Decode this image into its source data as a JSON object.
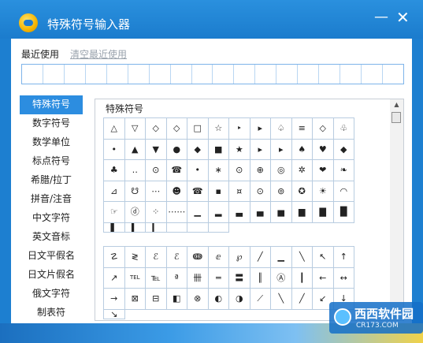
{
  "window": {
    "title": "特殊符号输入器",
    "minimize": "—",
    "close": "✕"
  },
  "recent": {
    "label": "最近使用",
    "clear": "清空最近使用",
    "slots": 18
  },
  "sidebar": {
    "items": [
      {
        "label": "特殊符号",
        "active": true
      },
      {
        "label": "数字符号"
      },
      {
        "label": "数学单位"
      },
      {
        "label": "标点符号"
      },
      {
        "label": "希腊/拉丁"
      },
      {
        "label": "拼音/注音"
      },
      {
        "label": "中文字符"
      },
      {
        "label": "英文音标"
      },
      {
        "label": "日文平假名"
      },
      {
        "label": "日文片假名"
      },
      {
        "label": "俄文字符"
      },
      {
        "label": "制表符"
      }
    ]
  },
  "panel": {
    "title": "特殊符号",
    "grid1": [
      [
        "△",
        "▽",
        "◇",
        "◇",
        "□",
        "☆",
        "‣",
        "▸",
        "♤",
        "≡",
        "◇",
        "♧",
        "•"
      ],
      [
        "▲",
        "▼",
        "●",
        "◆",
        "■",
        "★",
        "▸",
        "▸",
        "♠",
        "♥",
        "◆",
        "♣",
        "‥"
      ],
      [
        "⊙",
        "☎",
        "•",
        "∗",
        "⊙",
        "⊕",
        "◎",
        "✲",
        "❤",
        "❧",
        "⊿",
        "☋",
        "⋯"
      ],
      [
        "☻",
        "☎",
        "▪",
        "¤",
        "⊙",
        "⊚",
        "✪",
        "☀",
        "◠",
        "☞",
        "ⓓ",
        "⁘",
        "⋯⋯"
      ],
      [
        "▁",
        "▂",
        "▃",
        "▄",
        "▅",
        "▆",
        "▇",
        "█",
        "▌",
        "▍",
        "▎",
        "",
        "",
        ""
      ]
    ],
    "grid2": [
      [
        "☡",
        "≷",
        "ℰ",
        "ℰ",
        "ↈ",
        "ⅇ",
        "℘",
        "╱",
        "▁",
        "╲",
        "↖",
        "↑",
        "↗"
      ],
      [
        "TEL",
        "℡",
        "ª",
        "卌",
        "═",
        "〓",
        "║",
        "Ⓐ",
        "┃",
        "←",
        "↔",
        "→"
      ],
      [
        "⊠",
        "⊟",
        "◧",
        "⊗",
        "◐",
        "◑",
        "⟋",
        "╲",
        "╱",
        "↙",
        "↓",
        "↘"
      ]
    ]
  },
  "watermark": {
    "text": "西西软件园",
    "url": "CR173.COM"
  },
  "colors": {
    "title_bar": "#1b7ccd",
    "accent": "#2c8de0",
    "grid_border": "#b8cce0"
  }
}
